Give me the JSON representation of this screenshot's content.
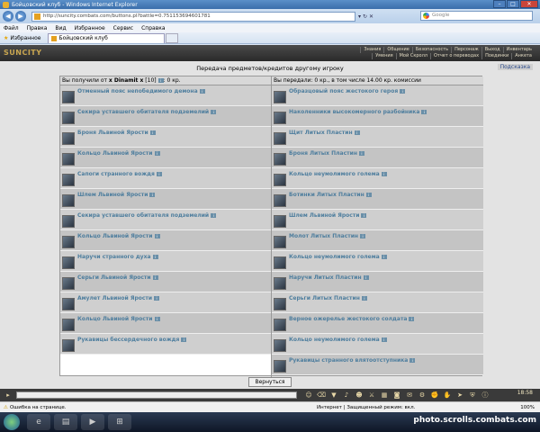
{
  "window": {
    "title": "Бойцовский клуб - Windows Internet Explorer"
  },
  "browser": {
    "url": "http://suncity.combats.com/buttons.pl?battle=0.751153694601781",
    "search_placeholder": "Google",
    "menu": [
      "Файл",
      "Правка",
      "Вид",
      "Избранное",
      "Сервис",
      "Справка"
    ],
    "favorites_label": "Избранное",
    "tab_title": "Бойцовский клуб"
  },
  "game": {
    "logo": "SUNCITY",
    "menu": [
      "Знания",
      "Общение",
      "Безопасность",
      "Персонаж",
      "Выход",
      "Инвентарь",
      "Умения",
      "Мой Скролл",
      "Отчет о переводах",
      "Поединки",
      "Анкета"
    ]
  },
  "trade": {
    "heading": "Передача предметов/кредитов другому игроку",
    "help": "Подсказка",
    "received": {
      "prefix": "Вы получили от",
      "player": "x Dinamit x",
      "level": "[10]",
      "amount": ": 0 кр."
    },
    "given": {
      "text": "Вы передали: 0 кр., в том числе 14.00 кр. комиссии"
    },
    "left_items": [
      "Отменный пояс непобедимого демона",
      "Секира уставшего обитателя подземелий",
      "Броня Львиной Ярости",
      "Кольцо Львиной Ярости",
      "Сапоги странного вождя",
      "Шлем Львиной Ярости",
      "Секира уставшего обитателя подземелий",
      "Кольцо Львиной Ярости",
      "Наручи странного духа",
      "Серьги Львиной Ярости",
      "Амулет Львиной Ярости",
      "Кольцо Львиной Ярости",
      "Рукавицы бессердечного вождя"
    ],
    "right_items": [
      "Образцовый пояс жестокого героя",
      "Наколенники высокомерного разбойника",
      "Щит Литых Пластин",
      "Броня Литых Пластин",
      "Кольцо неумолимого голема",
      "Ботинки Литых Пластин",
      "Шлем Львиной Ярости",
      "Молот Литых Пластин",
      "Кольцо неумолимого голема",
      "Наручи Литых Пластин",
      "Серьги Литых Пластин",
      "Верное ожерелье жестокого солдата",
      "Кольцо неумолимого голема",
      "Рукавицы странного влятоотступника"
    ],
    "info_badge": "i",
    "return_button": "Вернуться"
  },
  "game_toolbar": {
    "clock": "18:58"
  },
  "status": {
    "error": "Ошибка на странице.",
    "zone": "Интернет | Защищенный режим: вкл.",
    "zoom": "100%"
  },
  "taskbar": {
    "watermark": "photo.scrolls.combats.com"
  }
}
